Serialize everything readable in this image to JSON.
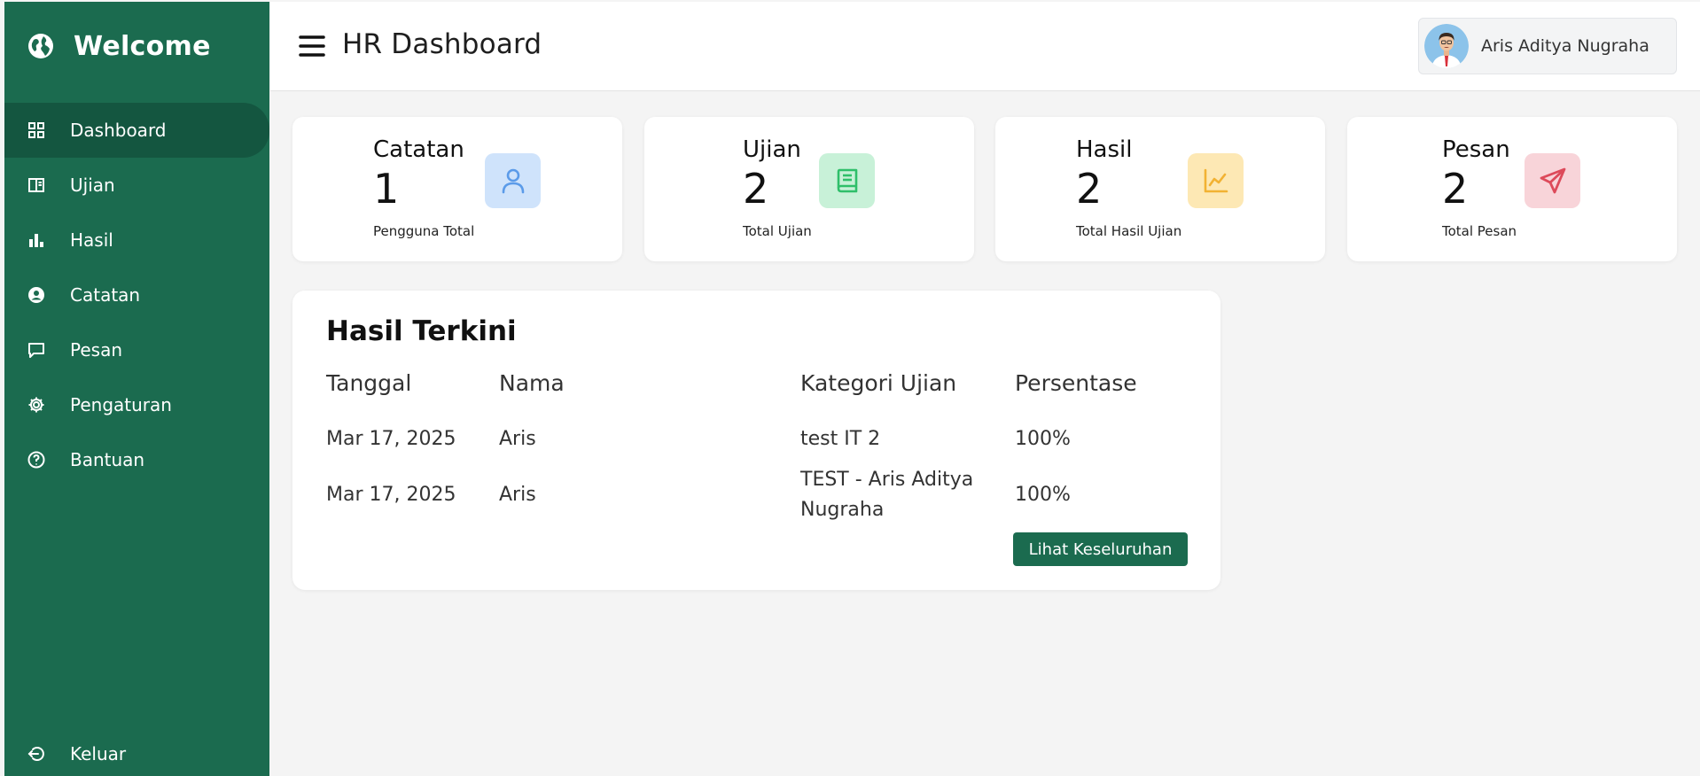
{
  "sidebar": {
    "brand": "Welcome",
    "items": [
      {
        "label": "Dashboard",
        "icon": "grid-icon"
      },
      {
        "label": "Ujian",
        "icon": "book-open-icon"
      },
      {
        "label": "Hasil",
        "icon": "bar-chart-icon"
      },
      {
        "label": "Catatan",
        "icon": "user-circle-icon"
      },
      {
        "label": "Pesan",
        "icon": "message-icon"
      },
      {
        "label": "Pengaturan",
        "icon": "gear-icon"
      },
      {
        "label": "Bantuan",
        "icon": "help-icon"
      }
    ],
    "active": "Dashboard",
    "logout_label": "Keluar"
  },
  "header": {
    "title": "HR Dashboard",
    "user_name": "Aris Aditya Nugraha"
  },
  "cards": [
    {
      "title": "Catatan",
      "value": "1",
      "subtitle": "Pengguna Total",
      "icon": "user-icon",
      "icon_bg": "#cfe3fb",
      "icon_color": "#5b9be9"
    },
    {
      "title": "Ujian",
      "value": "2",
      "subtitle": "Total Ujian",
      "icon": "book-icon",
      "icon_bg": "#c8f1d8",
      "icon_color": "#2fbf6a"
    },
    {
      "title": "Hasil",
      "value": "2",
      "subtitle": "Total Hasil Ujian",
      "icon": "line-chart-icon",
      "icon_bg": "#fde8b4",
      "icon_color": "#f2b233"
    },
    {
      "title": "Pesan",
      "value": "2",
      "subtitle": "Total Pesan",
      "icon": "send-icon",
      "icon_bg": "#f8d4d9",
      "icon_color": "#dd4a5a"
    }
  ],
  "results": {
    "title": "Hasil Terkini",
    "columns": [
      "Tanggal",
      "Nama",
      "Kategori Ujian",
      "Persentase"
    ],
    "rows": [
      {
        "tanggal": "Mar 17, 2025",
        "nama": "Aris",
        "kategori_line1": "test IT 2",
        "kategori_line2": "",
        "persentase": "100%"
      },
      {
        "tanggal": "Mar 17, 2025",
        "nama": "Aris",
        "kategori_line1": "TEST - Aris Aditya",
        "kategori_line2": "Nugraha",
        "persentase": "100%"
      }
    ],
    "view_all_label": "Lihat Keseluruhan"
  },
  "colors": {
    "sidebar": "#1b6b4f",
    "sidebar_active": "#145640",
    "accent": "#1b6b4f",
    "background": "#f4f4f4"
  }
}
